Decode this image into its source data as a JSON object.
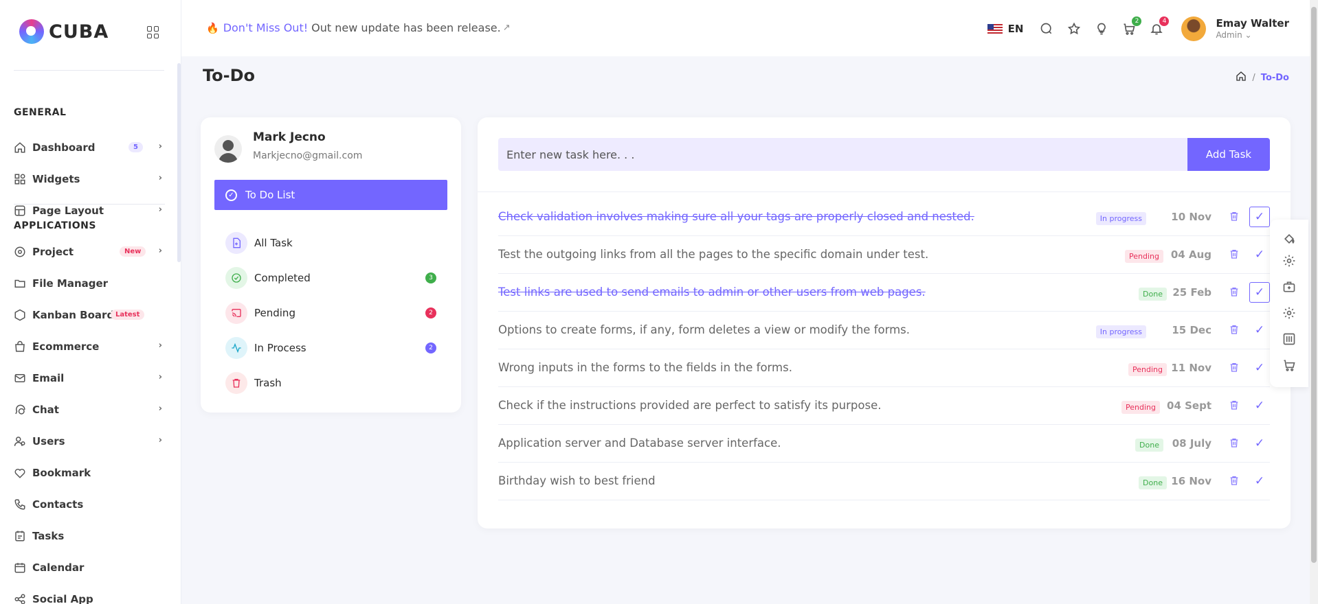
{
  "app": {
    "name": "CUBA"
  },
  "sidebar": {
    "general_title": "GENERAL",
    "applications_title": "APPLICATIONS",
    "items": [
      {
        "label": "Dashboard",
        "badge": "5",
        "icon": "home-icon"
      },
      {
        "label": "Widgets",
        "icon": "widgets-icon"
      },
      {
        "label": "Page Layout",
        "icon": "layout-icon"
      },
      {
        "label": "Project",
        "badge": "New",
        "icon": "project-icon"
      },
      {
        "label": "File Manager",
        "icon": "file-icon"
      },
      {
        "label": "Kanban Board",
        "badge": "Latest",
        "icon": "kanban-icon"
      },
      {
        "label": "Ecommerce",
        "icon": "bag-icon"
      },
      {
        "label": "Email",
        "icon": "mail-icon"
      },
      {
        "label": "Chat",
        "icon": "chat-icon"
      },
      {
        "label": "Users",
        "icon": "users-icon"
      },
      {
        "label": "Bookmark",
        "icon": "heart-icon"
      },
      {
        "label": "Contacts",
        "icon": "phone-icon"
      },
      {
        "label": "Tasks",
        "icon": "tasks-icon"
      },
      {
        "label": "Calendar",
        "icon": "calendar-icon"
      },
      {
        "label": "Social App",
        "icon": "social-icon"
      }
    ]
  },
  "header": {
    "announce_highlight": "Don't Miss Out!",
    "announce_text": "Out new update has been release.",
    "language": "EN",
    "cart_count": "2",
    "notification_count": "4",
    "user_name": "Emay Walter",
    "user_role": "Admin"
  },
  "page": {
    "title": "To-Do",
    "breadcrumb_sep": "/",
    "breadcrumb_current": "To-Do"
  },
  "profile": {
    "name": "Mark Jecno",
    "email": "Markjecno@gmail.com",
    "todo_button": "To Do List"
  },
  "filters": [
    {
      "label": "All Task",
      "count": ""
    },
    {
      "label": "Completed",
      "count": "3"
    },
    {
      "label": "Pending",
      "count": "2"
    },
    {
      "label": "In Process",
      "count": "2"
    },
    {
      "label": "Trash",
      "count": ""
    }
  ],
  "task_form": {
    "placeholder": "Enter new task here. . .",
    "add_button": "Add Task"
  },
  "tasks": [
    {
      "text": "Check validation involves making sure all your tags are properly closed and nested.",
      "status": "In progress",
      "date": "10 Nov",
      "completed": true
    },
    {
      "text": "Test the outgoing links from all the pages to the specific domain under test.",
      "status": "Pending",
      "date": "04 Aug",
      "completed": false
    },
    {
      "text": "Test links are used to send emails to admin or other users from web pages.",
      "status": "Done",
      "date": "25 Feb",
      "completed": true
    },
    {
      "text": "Options to create forms, if any, form deletes a view or modify the forms.",
      "status": "In progress",
      "date": "15 Dec",
      "completed": false
    },
    {
      "text": "Wrong inputs in the forms to the fields in the forms.",
      "status": "Pending",
      "date": "11 Nov",
      "completed": false
    },
    {
      "text": "Check if the instructions provided are perfect to satisfy its purpose.",
      "status": "Pending",
      "date": "04 Sept",
      "completed": false
    },
    {
      "text": "Application server and Database server interface.",
      "status": "Done",
      "date": "08 July",
      "completed": false
    },
    {
      "text": "Birthday wish to best friend",
      "status": "Done",
      "date": "16 Nov",
      "completed": false
    }
  ],
  "colors": {
    "accent": "#7366ff",
    "pending": "#e8315b",
    "done": "#3fae4b"
  }
}
